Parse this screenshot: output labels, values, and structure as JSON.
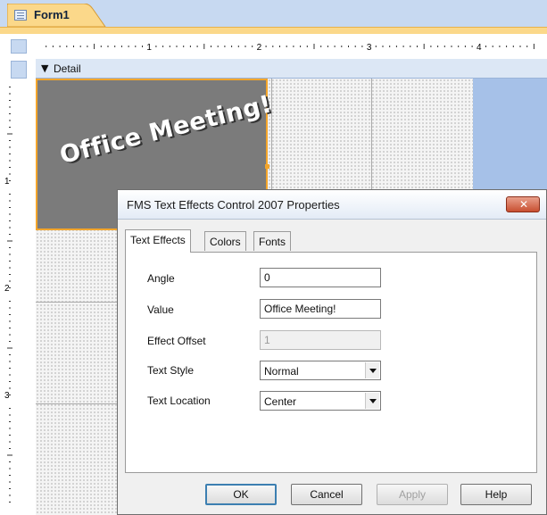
{
  "document_tab": {
    "label": "Form1",
    "icon": "form-icon"
  },
  "ruler": {
    "horizontal_marks": [
      "1",
      "2",
      "3",
      "4"
    ],
    "vertical_marks": [
      "1",
      "2",
      "3"
    ]
  },
  "section": {
    "label": "Detail",
    "icon": "section-arrow-icon"
  },
  "text_effect_control": {
    "text": "Office Meeting!"
  },
  "dialog": {
    "title": "FMS Text Effects Control 2007 Properties",
    "tabs": [
      {
        "label": "Text Effects",
        "active": true
      },
      {
        "label": "Colors",
        "active": false
      },
      {
        "label": "Fonts",
        "active": false
      }
    ],
    "fields": {
      "angle": {
        "label": "Angle",
        "value": "0"
      },
      "value": {
        "label": "Value",
        "value": "Office Meeting!"
      },
      "effect_offset": {
        "label": "Effect Offset",
        "value": "1"
      },
      "text_style": {
        "label": "Text Style",
        "value": "Normal"
      },
      "text_location": {
        "label": "Text Location",
        "value": "Center"
      }
    },
    "buttons": {
      "ok": "OK",
      "cancel": "Cancel",
      "apply": "Apply",
      "help": "Help"
    }
  },
  "colors": {
    "tab_strip": "#c7d9f1",
    "accent": "#f3a52b",
    "designer_blue": "#a6c1e8",
    "control_bg": "#7b7b7b"
  }
}
